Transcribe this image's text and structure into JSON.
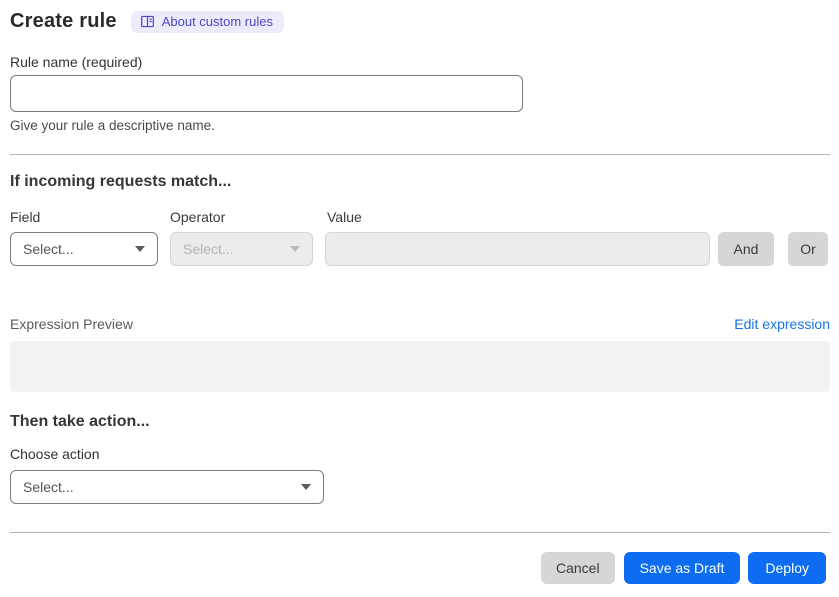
{
  "header": {
    "title": "Create rule",
    "badge_label": "About custom rules"
  },
  "rule_name": {
    "label": "Rule name (required)",
    "value": "",
    "placeholder": "",
    "helper": "Give your rule a descriptive name."
  },
  "match_section": {
    "heading": "If incoming requests match...",
    "field_label": "Field",
    "operator_label": "Operator",
    "value_label": "Value",
    "field_select_value": "Select...",
    "operator_select_value": "Select...",
    "value_input_value": "",
    "and_button": "And",
    "or_button": "Or"
  },
  "expression": {
    "label": "Expression Preview",
    "edit_link": "Edit expression",
    "preview_content": ""
  },
  "action_section": {
    "heading": "Then take action...",
    "choose_label": "Choose action",
    "action_select_value": "Select..."
  },
  "footer": {
    "cancel": "Cancel",
    "save_draft": "Save as Draft",
    "deploy": "Deploy"
  },
  "colors": {
    "primary_button": "#0C6CF2",
    "link": "#1672E3",
    "badge_bg": "#ECEBFC",
    "badge_text": "#4A48C9",
    "disabled_bg": "#ECECEC",
    "neutral_button": "#D6D6D6"
  }
}
